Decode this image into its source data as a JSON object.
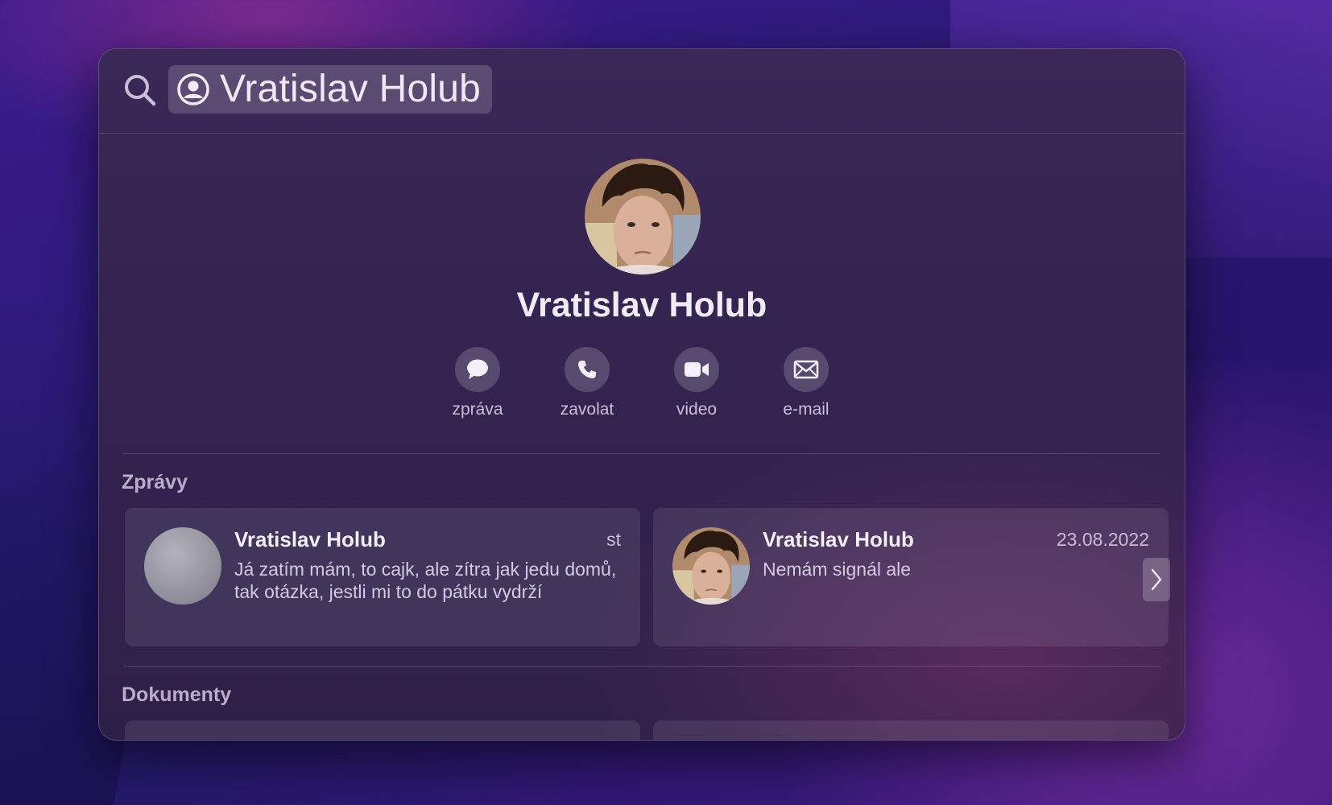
{
  "search": {
    "icon": "search-icon",
    "token_icon": "person-circle-icon",
    "query": "Vratislav Holub"
  },
  "contact": {
    "name": "Vratislav Holub",
    "actions": [
      {
        "icon": "message-bubble-icon",
        "label": "zpráva"
      },
      {
        "icon": "phone-icon",
        "label": "zavolat"
      },
      {
        "icon": "video-camera-icon",
        "label": "video"
      },
      {
        "icon": "envelope-icon",
        "label": "e-mail"
      }
    ]
  },
  "messages": {
    "title": "Zprávy",
    "items": [
      {
        "name": "Vratislav Holub",
        "date": "st",
        "text": "Já zatím mám, to cajk, ale zítra jak jedu domů, tak otázka, jestli mi to do pátku vydrží"
      },
      {
        "name": "Vratislav Holub",
        "date": "23.08.2022",
        "text": "Nemám signál ale"
      }
    ]
  },
  "documents": {
    "title": "Dokumenty"
  },
  "colors": {
    "panel": "#362552",
    "accent_text": "#f1ebf6",
    "muted_text": "#b8aec9"
  }
}
